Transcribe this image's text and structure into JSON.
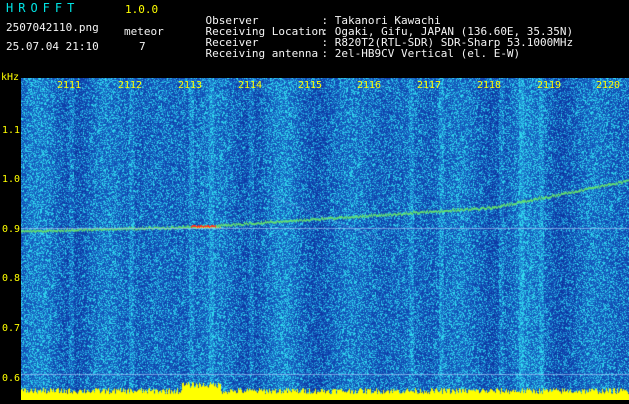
{
  "app": {
    "title": "HROFFT",
    "version": "1.0.0",
    "filename": "2507042110.png",
    "datetime": "25.07.04 21:10",
    "meteor_label": "meteor",
    "meteor_count": "7"
  },
  "info": [
    {
      "key": "Observer",
      "value": "Takanori Kawachi"
    },
    {
      "key": "Receiving Location",
      "value": "Ogaki, Gifu, JAPAN (136.60E, 35.35N)"
    },
    {
      "key": "Receiver",
      "value": "R820T2(RTL-SDR) SDR-Sharp 53.1000MHz"
    },
    {
      "key": "Receiving antenna",
      "value": "2el-HB9CV Vertical (el. E-W)"
    }
  ],
  "axes": {
    "y_unit": "kHz",
    "y_ticks": [
      "1.1",
      "1.0",
      "0.9",
      "0.8",
      "0.7",
      "0.6"
    ],
    "x_ticks": [
      "2111",
      "2112",
      "2113",
      "2114",
      "2115",
      "2116",
      "2117",
      "2118",
      "2119",
      "2120"
    ]
  },
  "colors": {
    "background": "#000000",
    "label_yellow": "#ffff00",
    "title_cyan": "#00e4e4",
    "spectrum_low": "#0a2a9c",
    "spectrum_high": "#3fd6e0",
    "baseline_yellow": "#ffff00"
  }
}
